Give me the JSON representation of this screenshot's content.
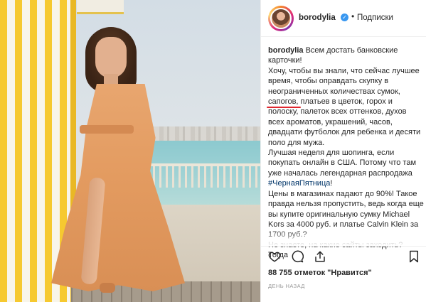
{
  "post": {
    "username": "borodylia",
    "verified_icon": "verified-badge-icon",
    "dot": "•",
    "follow_label": "Подписки"
  },
  "caption": {
    "username": "borodylia",
    "line_1": "Всем достать банковские карточки!",
    "line_2_pre": "Хочу, чтобы вы знали, что сейчас лучшее время, чтобы оправдать скупку в неограниченных количествах сумок,",
    "highlight": "сапогов,",
    "line_2_post": "платьев в цветок, горох и полоску, палеток всех оттенков, духов всех ароматов, украшений, часов, двадцати футболок для ребенка и десяти поло для мужа.",
    "line_3": "Лучшая неделя для шопинга, если покупать онлайн в США. Потому что там уже началась легендарная распродажа",
    "hashtag": "#ЧернаяПятница",
    "line_3_end": "!",
    "line_4": "Цены в магазинах падают до 90%! Такое правда нельзя пропустить, ведь когда еще вы купите оригинальную сумку Michael Kors за 4000 руб. и платье Calvin Klein за 1700 руб.?",
    "line_5": "Не знаете, на какие сайты заходить? Тогда"
  },
  "actions": {
    "like_icon": "heart-icon",
    "comment_icon": "comment-icon",
    "share_icon": "share-icon",
    "save_icon": "bookmark-icon"
  },
  "likes": {
    "count": "88 755",
    "label": "отметок \"Нравится\""
  },
  "timestamp": "ДЕНЬ НАЗАД"
}
